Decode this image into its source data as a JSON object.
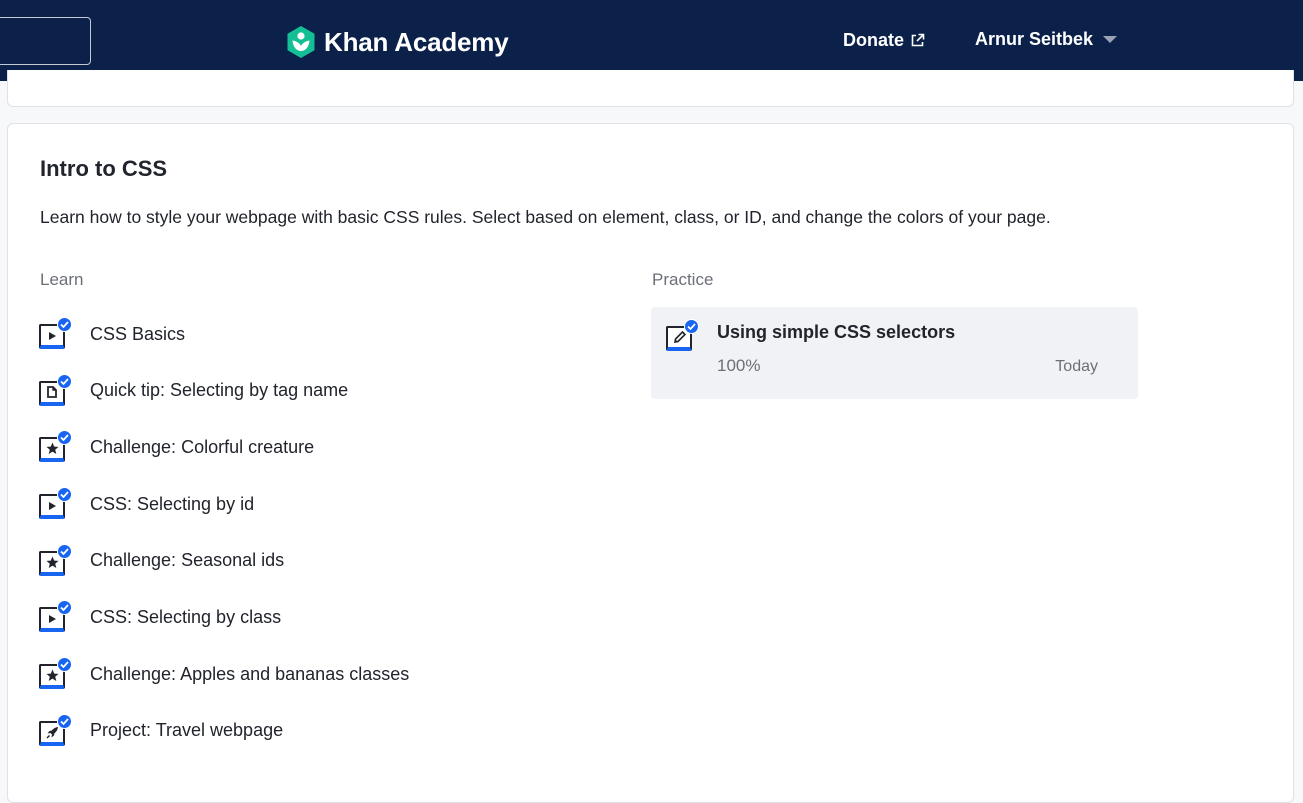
{
  "header": {
    "brand": "Khan Academy",
    "donate_label": "Donate",
    "user_name": "Arnur Seitbek",
    "colors": {
      "background": "#0b2149",
      "text": "#ffffff"
    }
  },
  "unit": {
    "title": "Intro to CSS",
    "description": "Learn how to style your webpage with basic CSS rules. Select based on element, class, or ID, and change the colors of your page.",
    "learn_heading": "Learn",
    "practice_heading": "Practice",
    "learn_items": [
      {
        "label": "CSS Basics",
        "icon": "video-icon",
        "completed": true
      },
      {
        "label": "Quick tip: Selecting by tag name",
        "icon": "article-icon",
        "completed": true
      },
      {
        "label": "Challenge: Colorful creature",
        "icon": "star-icon",
        "completed": true
      },
      {
        "label": "CSS: Selecting by id",
        "icon": "video-icon",
        "completed": true
      },
      {
        "label": "Challenge: Seasonal ids",
        "icon": "star-icon",
        "completed": true
      },
      {
        "label": "CSS: Selecting by class",
        "icon": "video-icon",
        "completed": true
      },
      {
        "label": "Challenge: Apples and bananas classes",
        "icon": "star-icon",
        "completed": true
      },
      {
        "label": "Project: Travel webpage",
        "icon": "rocket-icon",
        "completed": true
      }
    ],
    "practice_items": [
      {
        "title": "Using simple CSS selectors",
        "percent": "100%",
        "date": "Today",
        "icon": "pencil-icon",
        "completed": true
      }
    ]
  },
  "colors": {
    "accent": "#1865f2",
    "text_primary": "#21242c",
    "text_secondary": "#6b6f78",
    "practice_bg": "#f1f2f5"
  }
}
